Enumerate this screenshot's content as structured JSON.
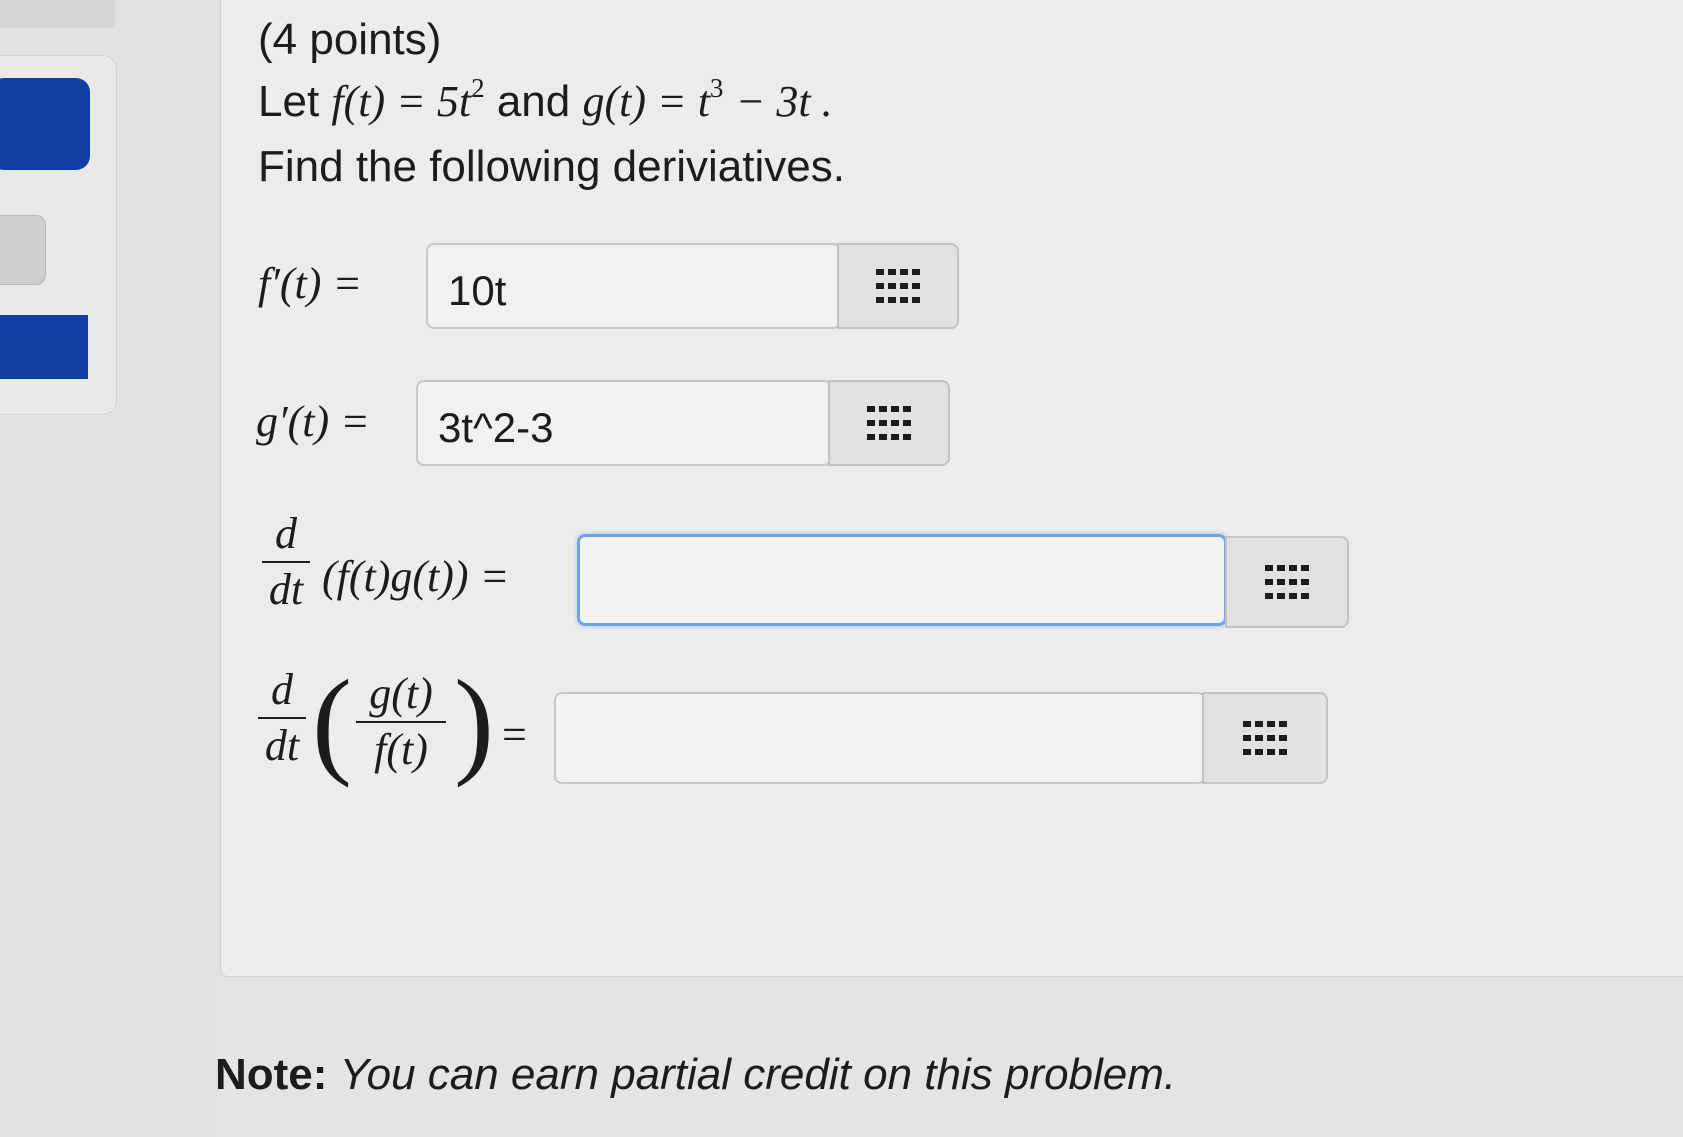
{
  "problem": {
    "points": "(4 points)",
    "intro": {
      "let": "Let",
      "f_def": "f(t) = 5t",
      "f_exp": "2",
      "and": "and",
      "g_def": "g(t) = t",
      "g_exp": "3",
      "g_tail": "− 3t ."
    },
    "instruction": "Find the following deriviatives."
  },
  "questions": [
    {
      "label": "f′(t) =",
      "value": "10t"
    },
    {
      "label": "g′(t) =",
      "value": "3t^2-3"
    },
    {
      "d": "d",
      "dt": "dt",
      "expr": "(f(t)g(t)) =",
      "value": ""
    },
    {
      "d": "d",
      "dt": "dt",
      "num": "g(t)",
      "den": "f(t)",
      "lparen": "(",
      "rparen": ")",
      "eq": "=",
      "value": ""
    }
  ],
  "note": {
    "bold": "Note:",
    "italic": "You can earn partial credit on this problem."
  },
  "colors": {
    "sidebar_blue": "#0f3fa3",
    "focus_border": "#6fa3e4"
  },
  "icons": [
    "grid-keypad-icon"
  ]
}
